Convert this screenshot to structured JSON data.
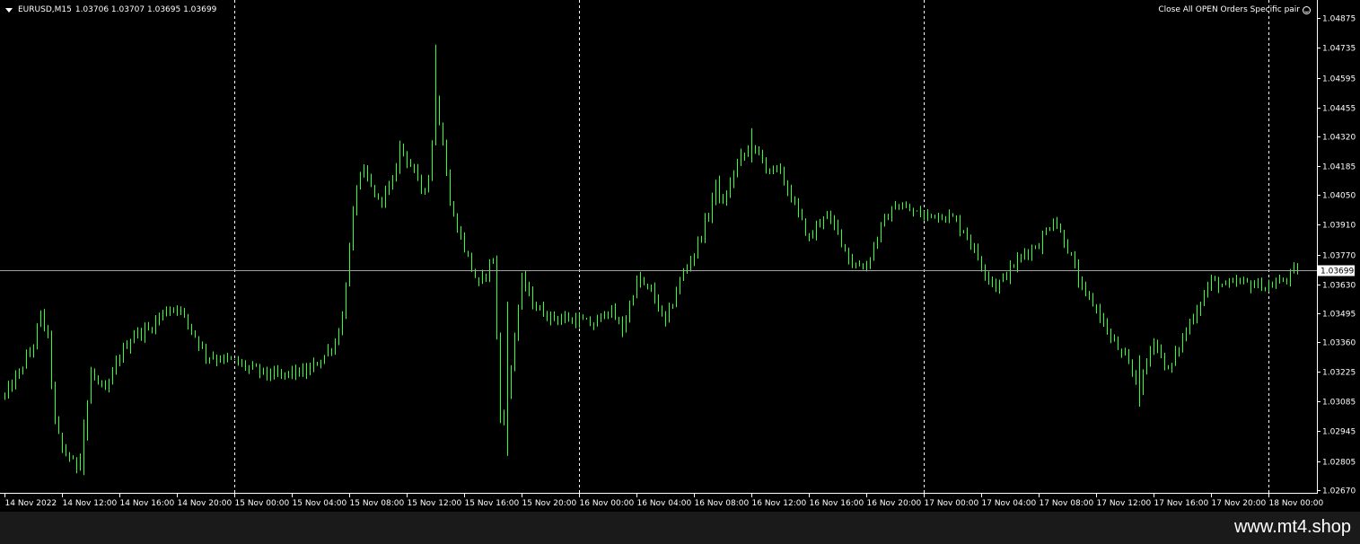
{
  "chart_header": {
    "symbol_timeframe": "EURUSD,M15",
    "ohlc": "1.03706 1.03707 1.03695 1.03699"
  },
  "ea_label": "Close All OPEN Orders Specific pair",
  "footer_url": "www.mt4.shop",
  "colors": {
    "background": "#000000",
    "candle": "#33ff33",
    "grid_separator": "#ffffff",
    "bid_line": "#a0a0a0",
    "axis": "#ffffff",
    "footer_bg": "#1a1a1a"
  },
  "chart_data": {
    "type": "candlestick",
    "symbol": "EURUSD",
    "timeframe": "M15",
    "current_price": "1.03699",
    "ylim": [
      1.0267,
      1.049
    ],
    "y_ticks": [
      "1.04875",
      "1.04735",
      "1.04595",
      "1.04455",
      "1.04320",
      "1.04185",
      "1.04050",
      "1.03910",
      "1.03770",
      "1.03630",
      "1.03495",
      "1.03360",
      "1.03225",
      "1.03085",
      "1.02945",
      "1.02805",
      "1.02670"
    ],
    "x_ticks": [
      "14 Nov 2022",
      "14 Nov 12:00",
      "14 Nov 16:00",
      "14 Nov 20:00",
      "15 Nov 00:00",
      "15 Nov 04:00",
      "15 Nov 08:00",
      "15 Nov 12:00",
      "15 Nov 16:00",
      "15 Nov 20:00",
      "16 Nov 00:00",
      "16 Nov 04:00",
      "16 Nov 08:00",
      "16 Nov 12:00",
      "16 Nov 16:00",
      "16 Nov 20:00",
      "17 Nov 00:00",
      "17 Nov 04:00",
      "17 Nov 08:00",
      "17 Nov 12:00",
      "17 Nov 16:00",
      "17 Nov 20:00",
      "18 Nov 00:00"
    ],
    "day_separators": [
      "15 Nov 00:00",
      "16 Nov 00:00",
      "17 Nov 00:00",
      "18 Nov 00:00"
    ],
    "close_path": [
      [
        "14 Nov 08:00",
        1.0311
      ],
      [
        "14 Nov 09:00",
        1.0322
      ],
      [
        "14 Nov 10:00",
        1.0335
      ],
      [
        "14 Nov 10:30",
        1.0349
      ],
      [
        "14 Nov 11:00",
        1.0338
      ],
      [
        "14 Nov 11:30",
        1.0298
      ],
      [
        "14 Nov 12:00",
        1.0286
      ],
      [
        "14 Nov 13:00",
        1.0278
      ],
      [
        "14 Nov 13:30",
        1.0293
      ],
      [
        "14 Nov 14:00",
        1.0322
      ],
      [
        "14 Nov 15:00",
        1.0312
      ],
      [
        "14 Nov 16:00",
        1.033
      ],
      [
        "14 Nov 17:00",
        1.034
      ],
      [
        "14 Nov 18:00",
        1.0342
      ],
      [
        "14 Nov 19:00",
        1.035
      ],
      [
        "14 Nov 20:00",
        1.0353
      ],
      [
        "14 Nov 21:00",
        1.0342
      ],
      [
        "14 Nov 22:00",
        1.033
      ],
      [
        "15 Nov 00:00",
        1.0327
      ],
      [
        "15 Nov 01:00",
        1.0324
      ],
      [
        "15 Nov 02:00",
        1.0322
      ],
      [
        "15 Nov 03:00",
        1.032
      ],
      [
        "15 Nov 04:00",
        1.0322
      ],
      [
        "15 Nov 05:00",
        1.0322
      ],
      [
        "15 Nov 06:00",
        1.0328
      ],
      [
        "15 Nov 07:00",
        1.0336
      ],
      [
        "15 Nov 07:30",
        1.0348
      ],
      [
        "15 Nov 08:00",
        1.038
      ],
      [
        "15 Nov 08:30",
        1.041
      ],
      [
        "15 Nov 09:00",
        1.0415
      ],
      [
        "15 Nov 10:00",
        1.0402
      ],
      [
        "15 Nov 11:00",
        1.041
      ],
      [
        "15 Nov 11:30",
        1.0428
      ],
      [
        "15 Nov 12:00",
        1.0422
      ],
      [
        "15 Nov 13:00",
        1.0408
      ],
      [
        "15 Nov 13:30",
        1.0412
      ],
      [
        "15 Nov 14:00",
        1.045
      ],
      [
        "15 Nov 14:30",
        1.043
      ],
      [
        "15 Nov 15:00",
        1.04
      ],
      [
        "15 Nov 16:00",
        1.038
      ],
      [
        "15 Nov 17:00",
        1.0362
      ],
      [
        "15 Nov 18:00",
        1.0376
      ],
      [
        "15 Nov 18:30",
        1.03
      ],
      [
        "15 Nov 19:00",
        1.031
      ],
      [
        "15 Nov 19:30",
        1.034
      ],
      [
        "15 Nov 20:00",
        1.0365
      ],
      [
        "15 Nov 21:00",
        1.0352
      ],
      [
        "15 Nov 22:00",
        1.0348
      ],
      [
        "16 Nov 00:00",
        1.0346
      ],
      [
        "16 Nov 01:00",
        1.0344
      ],
      [
        "16 Nov 02:00",
        1.0352
      ],
      [
        "16 Nov 03:00",
        1.0342
      ],
      [
        "16 Nov 04:00",
        1.0365
      ],
      [
        "16 Nov 05:00",
        1.036
      ],
      [
        "16 Nov 06:00",
        1.0345
      ],
      [
        "16 Nov 07:00",
        1.0365
      ],
      [
        "16 Nov 08:00",
        1.0378
      ],
      [
        "16 Nov 09:00",
        1.0396
      ],
      [
        "16 Nov 09:30",
        1.041
      ],
      [
        "16 Nov 10:00",
        1.04
      ],
      [
        "16 Nov 11:00",
        1.042
      ],
      [
        "16 Nov 12:00",
        1.0428
      ],
      [
        "16 Nov 13:00",
        1.0418
      ],
      [
        "16 Nov 14:00",
        1.0415
      ],
      [
        "16 Nov 15:00",
        1.04
      ],
      [
        "16 Nov 16:00",
        1.0384
      ],
      [
        "16 Nov 17:00",
        1.0396
      ],
      [
        "16 Nov 18:00",
        1.0388
      ],
      [
        "16 Nov 19:00",
        1.0372
      ],
      [
        "16 Nov 20:00",
        1.0372
      ],
      [
        "16 Nov 21:00",
        1.039
      ],
      [
        "16 Nov 22:00",
        1.04
      ],
      [
        "17 Nov 00:00",
        1.0395
      ],
      [
        "17 Nov 01:00",
        1.0396
      ],
      [
        "17 Nov 02:00",
        1.0394
      ],
      [
        "17 Nov 03:00",
        1.0386
      ],
      [
        "17 Nov 04:00",
        1.0372
      ],
      [
        "17 Nov 05:00",
        1.0362
      ],
      [
        "17 Nov 06:00",
        1.037
      ],
      [
        "17 Nov 07:00",
        1.0378
      ],
      [
        "17 Nov 08:00",
        1.0382
      ],
      [
        "17 Nov 09:00",
        1.0394
      ],
      [
        "17 Nov 10:00",
        1.038
      ],
      [
        "17 Nov 11:00",
        1.036
      ],
      [
        "17 Nov 12:00",
        1.0352
      ],
      [
        "17 Nov 13:00",
        1.0338
      ],
      [
        "17 Nov 14:00",
        1.0328
      ],
      [
        "17 Nov 15:00",
        1.0315
      ],
      [
        "17 Nov 16:00",
        1.0338
      ],
      [
        "17 Nov 17:00",
        1.0322
      ],
      [
        "17 Nov 18:00",
        1.0338
      ],
      [
        "17 Nov 19:00",
        1.0352
      ],
      [
        "17 Nov 20:00",
        1.0365
      ],
      [
        "17 Nov 21:00",
        1.0362
      ],
      [
        "17 Nov 22:00",
        1.0364
      ],
      [
        "18 Nov 00:00",
        1.0362
      ],
      [
        "18 Nov 01:00",
        1.0365
      ],
      [
        "18 Nov 02:00",
        1.037
      ]
    ],
    "spikes": [
      [
        "15 Nov 14:00",
        1.0475,
        1.044
      ],
      [
        "15 Nov 19:00",
        1.0355,
        1.0283
      ],
      [
        "17 Nov 15:00",
        1.033,
        1.0306
      ],
      [
        "16 Nov 12:00",
        1.0436,
        1.042
      ],
      [
        "14 Nov 13:30",
        1.03,
        1.0274
      ]
    ]
  }
}
